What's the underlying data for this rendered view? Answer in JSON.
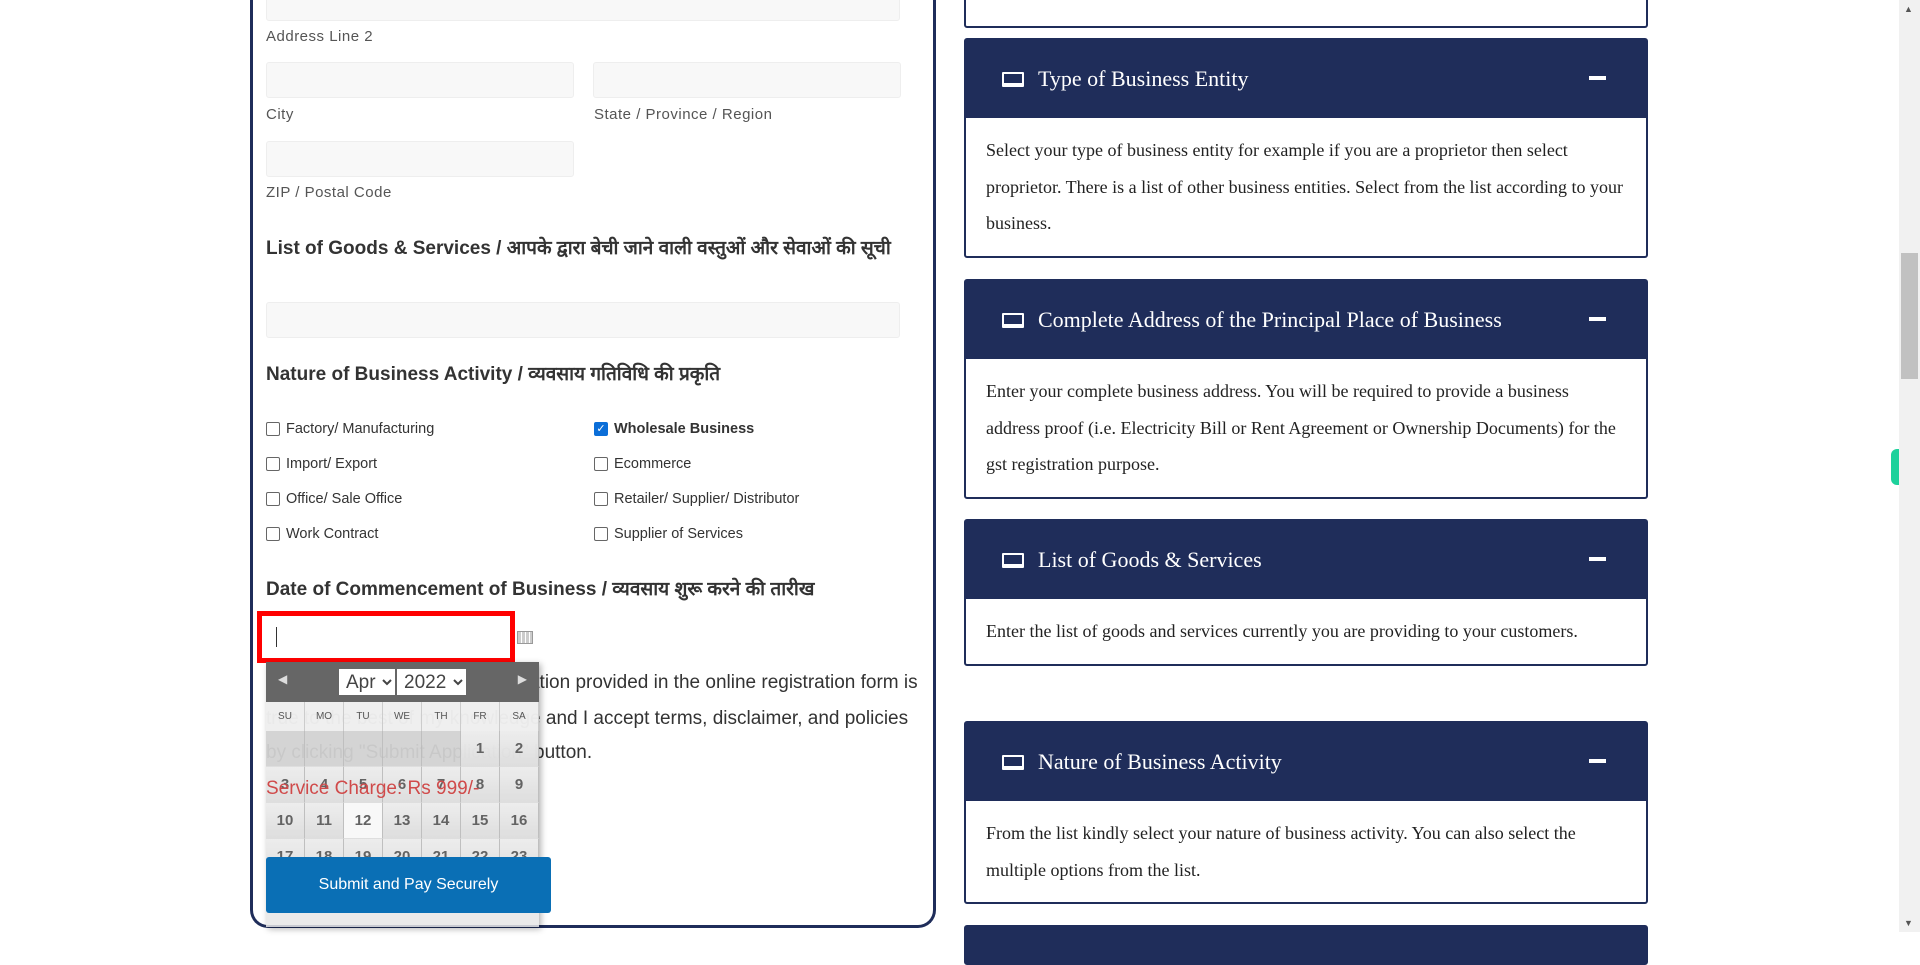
{
  "form": {
    "address_line2_label": "Address Line 2",
    "city_label": "City",
    "state_label": "State / Province / Region",
    "zip_label": "ZIP / Postal Code",
    "goods_heading": "List of Goods & Services / आपके द्वारा बेची जाने वाली वस्तुओं और सेवाओं की सूची",
    "nature_heading": "Nature of Business Activity / व्यवसाय गतिविधि की प्रकृति",
    "activities": [
      {
        "label": "Factory/ Manufacturing",
        "checked": false
      },
      {
        "label": "Wholesale Business",
        "checked": true
      },
      {
        "label": "Import/ Export",
        "checked": false
      },
      {
        "label": "Ecommerce",
        "checked": false
      },
      {
        "label": "Office/ Sale Office",
        "checked": false
      },
      {
        "label": "Retailer/ Supplier/ Distributor",
        "checked": false
      },
      {
        "label": "Work Contract",
        "checked": false
      },
      {
        "label": "Supplier of Services",
        "checked": false
      }
    ],
    "date_heading": "Date of Commencement of Business / व्यवसाय शुरू करने की तारीख",
    "declaration_line1": "I hereby declare that the information provided in the online registration form is",
    "declaration_line2": "true to the best of my knowledge and I accept terms, disclaimer, and policies",
    "declaration_line3": "by clicking \"Submit Application\" button.",
    "service_charge": "Service Charge: Rs 999/-",
    "submit_label": "Submit and Pay Securely"
  },
  "calendar": {
    "month": "Apr",
    "year": "2022",
    "day_names": [
      "SU",
      "MO",
      "TU",
      "WE",
      "TH",
      "FR",
      "SA"
    ],
    "first_weekday": 5,
    "days_in_month": 30,
    "today": 12
  },
  "help_panels": [
    {
      "title": "Type of Business Entity",
      "body": "Select your type of business entity for example if you are a proprietor then select proprietor. There is a list of other business entities. Select from the list according to your business."
    },
    {
      "title": "Complete Address of the Principal Place of Business",
      "body": "Enter your complete business address. You will be required to provide a business address proof (i.e. Electricity Bill or Rent Agreement or Ownership Documents) for the gst registration purpose."
    },
    {
      "title": "List of Goods & Services",
      "body": "Enter the list of goods and services currently you are providing to your customers."
    },
    {
      "title": "Nature of Business Activity",
      "body": "From the list kindly select your nature of business activity. You can also select the multiple options from the list."
    }
  ],
  "colors": {
    "navy": "#1f2d5a",
    "highlight": "#ff0000",
    "submit": "#0a6fb5",
    "widget": "#1dd19b"
  }
}
